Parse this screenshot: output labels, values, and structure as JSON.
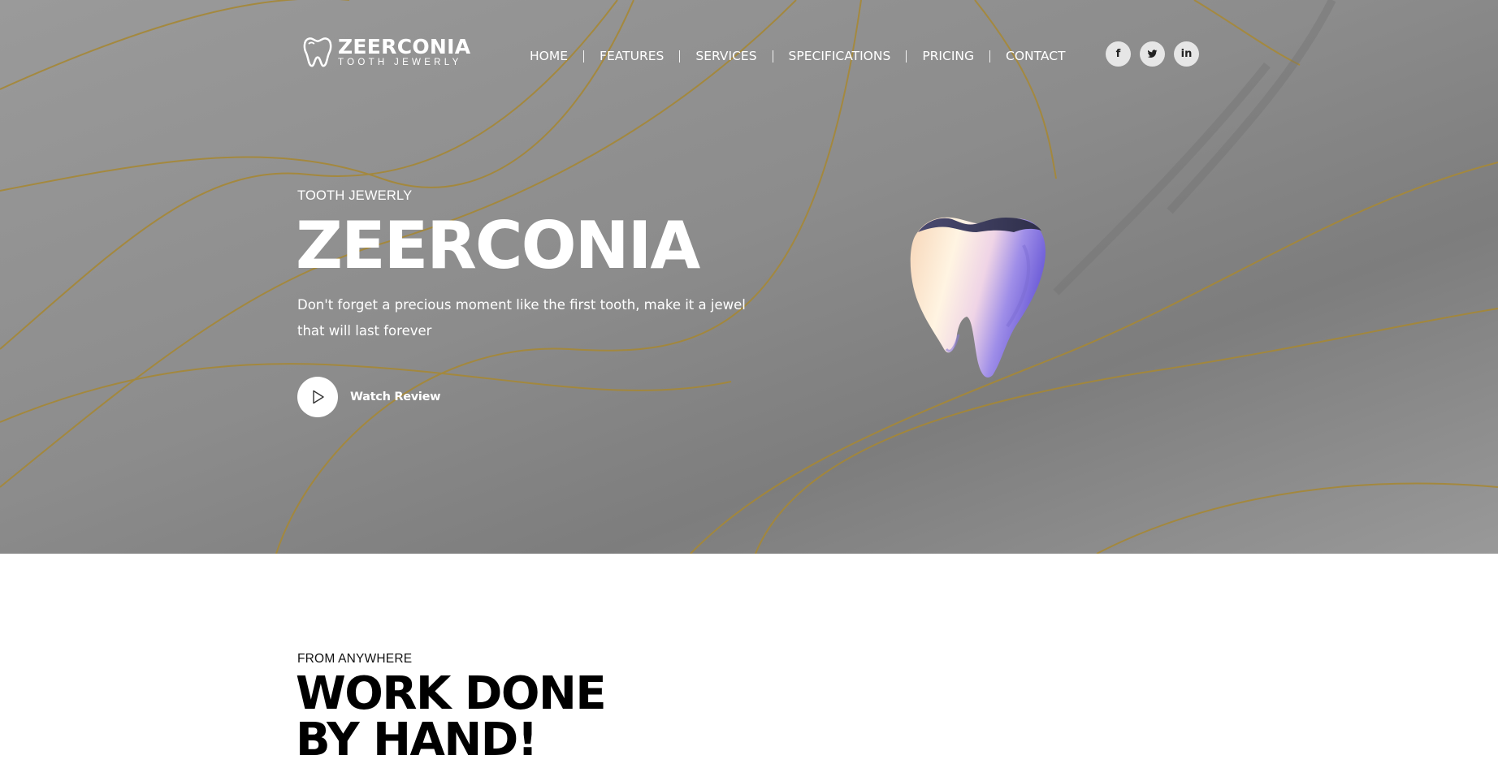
{
  "brand": {
    "name": "ZEERCONIA",
    "tagline": "TOOTH JEWERLY",
    "icon": "tooth-outline-icon"
  },
  "nav": {
    "items": [
      {
        "label": "HOME"
      },
      {
        "label": "FEATURES"
      },
      {
        "label": "SERVICES"
      },
      {
        "label": "SPECIFICATIONS"
      },
      {
        "label": "PRICING"
      },
      {
        "label": "CONTACT"
      }
    ]
  },
  "social": [
    {
      "name": "facebook",
      "icon": "facebook-icon",
      "glyph": "f"
    },
    {
      "name": "twitter",
      "icon": "twitter-icon"
    },
    {
      "name": "linkedin",
      "icon": "linkedin-icon",
      "glyph": "in"
    }
  ],
  "hero": {
    "eyebrow": "TOOTH JEWERLY",
    "title": "ZEERCONIA",
    "description": "Don't forget a precious moment like the first tooth, make it a jewel that will last forever",
    "cta_label": "Watch Review",
    "cta_icon": "play-icon",
    "image": "3d-tooth-render"
  },
  "section": {
    "eyebrow": "FROM ANYWHERE",
    "title_line1": "WORK DONE",
    "title_line2": "BY HAND!"
  },
  "colors": {
    "hero_background": "#8f8f8f",
    "gold_lines": "#a88a3a",
    "text_on_hero": "#ffffff",
    "section_title": "#000000"
  }
}
